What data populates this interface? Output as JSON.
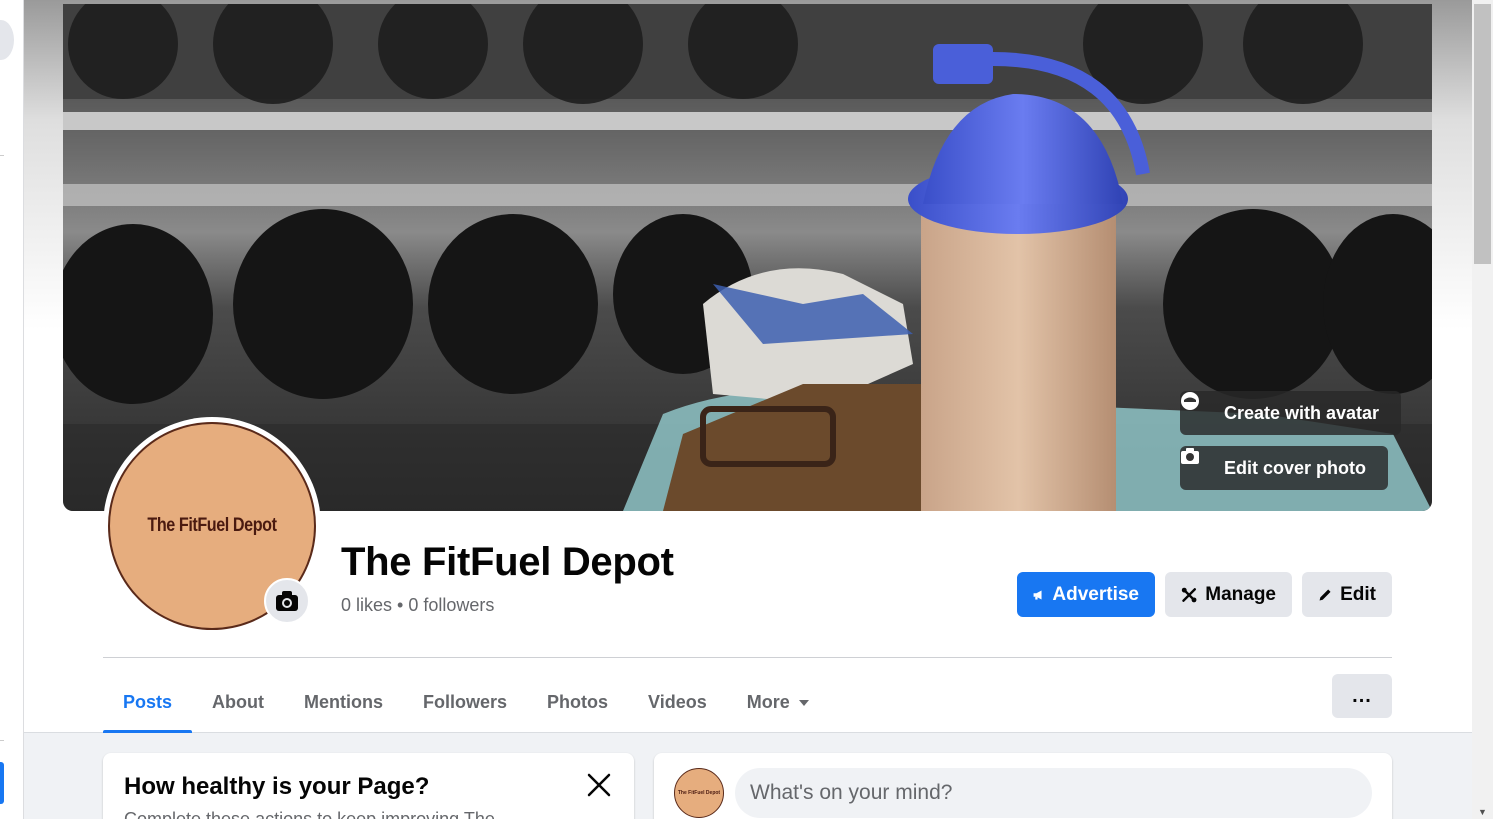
{
  "cover": {
    "create_avatar_label": "Create with avatar",
    "edit_cover_label": "Edit cover photo"
  },
  "profile": {
    "logo_text": "The FitFuel Depot",
    "page_name": "The FitFuel Depot",
    "stats": "0 likes • 0 followers"
  },
  "actions": {
    "advertise": "Advertise",
    "manage": "Manage",
    "edit": "Edit"
  },
  "tabs": [
    {
      "label": "Posts",
      "active": true
    },
    {
      "label": "About"
    },
    {
      "label": "Mentions"
    },
    {
      "label": "Followers"
    },
    {
      "label": "Photos"
    },
    {
      "label": "Videos"
    },
    {
      "label": "More"
    }
  ],
  "more_menu_label": "...",
  "health_card": {
    "title": "How healthy is your Page?",
    "subtitle": "Complete these actions to keep improving The"
  },
  "composer": {
    "avatar_text": "The FitFuel Depot",
    "placeholder": "What's on your mind?"
  },
  "colors": {
    "accent": "#1877f2",
    "logo_bg": "#e6ad7e"
  }
}
